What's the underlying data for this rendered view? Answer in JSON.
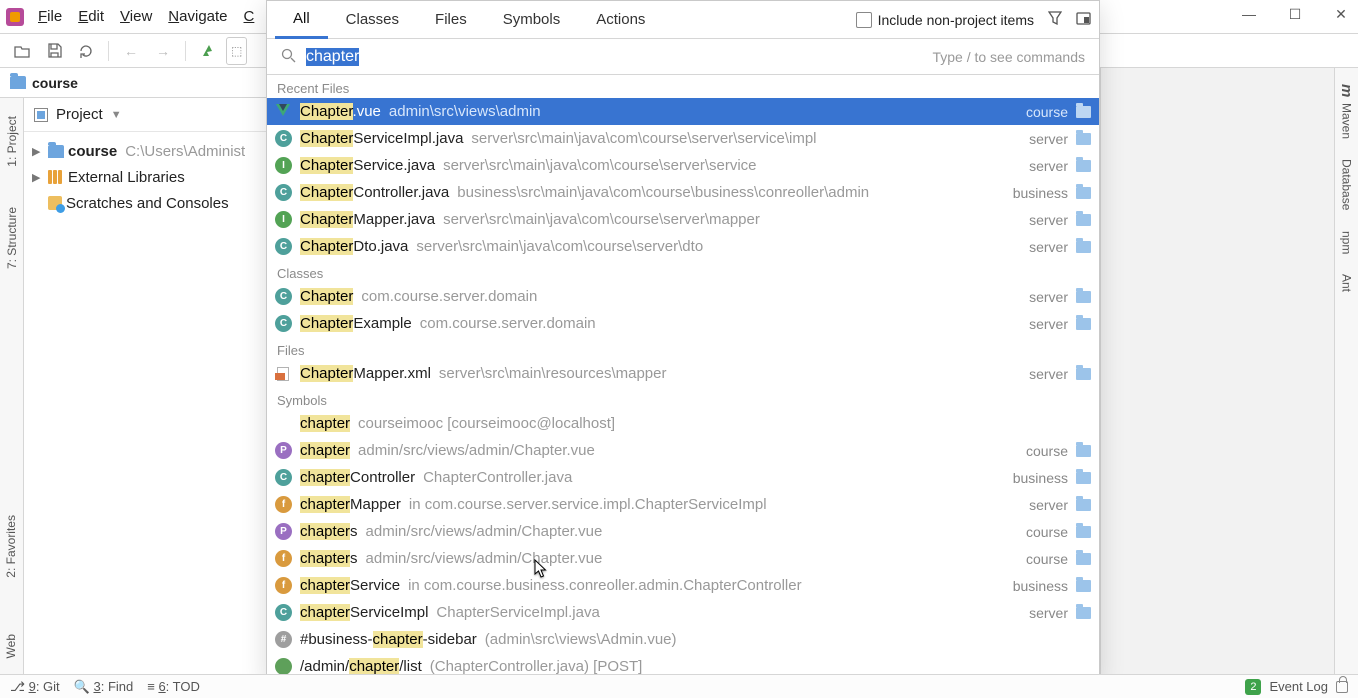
{
  "menu": {
    "file": "File",
    "edit": "Edit",
    "view": "View",
    "navigate": "Navigate",
    "code_initial": "C"
  },
  "toolbar": {},
  "breadcrumb": {
    "project": "course"
  },
  "leftpanel": {
    "header": "Project",
    "root": {
      "name": "course",
      "path": "C:\\Users\\Administ"
    },
    "external": "External Libraries",
    "scratches": "Scratches and Consoles"
  },
  "leftstripe": {
    "project": "1: Project",
    "structure": "7: Structure",
    "favorites": "2: Favorites",
    "web": "Web"
  },
  "rightstripe": {
    "maven": "Maven",
    "m": "m",
    "database": "Database",
    "npm": "npm",
    "ant": "Ant"
  },
  "wincontrols": {},
  "popup": {
    "tabs": {
      "all": "All",
      "classes": "Classes",
      "files": "Files",
      "symbols": "Symbols",
      "actions": "Actions"
    },
    "include": "Include non-project items",
    "query": "chapter",
    "hint": "Type / to see commands",
    "sections": {
      "recent": "Recent Files",
      "classes": "Classes",
      "files": "Files",
      "symbols": "Symbols"
    },
    "recent": [
      {
        "icon": "vue",
        "name": "Chapter.vue",
        "hl": "Chapter",
        "tail": ".vue",
        "path": "admin\\src\\views\\admin",
        "mod": "course",
        "sel": true
      },
      {
        "icon": "cyan",
        "letter": "C",
        "name": "ChapterServiceImpl.java",
        "hl": "Chapter",
        "tail": "ServiceImpl.java",
        "path": "server\\src\\main\\java\\com\\course\\server\\service\\impl",
        "mod": "server"
      },
      {
        "icon": "int",
        "letter": "I",
        "name": "ChapterService.java",
        "hl": "Chapter",
        "tail": "Service.java",
        "path": "server\\src\\main\\java\\com\\course\\server\\service",
        "mod": "server"
      },
      {
        "icon": "cyan",
        "letter": "C",
        "name": "ChapterController.java",
        "hl": "Chapter",
        "tail": "Controller.java",
        "path": "business\\src\\main\\java\\com\\course\\business\\conreoller\\admin",
        "mod": "business"
      },
      {
        "icon": "int",
        "letter": "I",
        "name": "ChapterMapper.java",
        "hl": "Chapter",
        "tail": "Mapper.java",
        "path": "server\\src\\main\\java\\com\\course\\server\\mapper",
        "mod": "server"
      },
      {
        "icon": "cyan",
        "letter": "C",
        "name": "ChapterDto.java",
        "hl": "Chapter",
        "tail": "Dto.java",
        "path": "server\\src\\main\\java\\com\\course\\server\\dto",
        "mod": "server"
      }
    ],
    "classes": [
      {
        "icon": "cyan",
        "letter": "C",
        "name": "Chapter",
        "hl": "Chapter",
        "tail": "",
        "path": "com.course.server.domain",
        "mod": "server"
      },
      {
        "icon": "cyan",
        "letter": "C",
        "name": "ChapterExample",
        "hl": "Chapter",
        "tail": "Example",
        "path": "com.course.server.domain",
        "mod": "server"
      }
    ],
    "files": [
      {
        "icon": "xml",
        "name": "ChapterMapper.xml",
        "hl": "Chapter",
        "tail": "Mapper.xml",
        "path": "server\\src\\main\\resources\\mapper",
        "mod": "server"
      }
    ],
    "symbols": [
      {
        "icon": "grid",
        "name": "chapter",
        "hl": "chapter",
        "tail": "",
        "path": "courseimooc [courseimooc@localhost]",
        "mod": ""
      },
      {
        "icon": "purple",
        "letter": "P",
        "name": "chapter",
        "hl": "chapter",
        "tail": "",
        "path": "admin/src/views/admin/Chapter.vue",
        "mod": "course"
      },
      {
        "icon": "cyan",
        "letter": "C",
        "name": "chapterController",
        "hl": "chapter",
        "tail": "Controller",
        "path": "ChapterController.java",
        "mod": "business"
      },
      {
        "icon": "orange",
        "letter": "f",
        "name": "chapterMapper",
        "hl": "chapter",
        "tail": "Mapper",
        "path": "in com.course.server.service.impl.ChapterServiceImpl",
        "mod": "server"
      },
      {
        "icon": "purple",
        "letter": "P",
        "name": "chapters",
        "hl": "chapter",
        "tail": "s",
        "path": "admin/src/views/admin/Chapter.vue",
        "mod": "course"
      },
      {
        "icon": "orange",
        "letter": "f",
        "name": "chapters",
        "hl": "chapter",
        "tail": "s",
        "path": "admin/src/views/admin/Chapter.vue",
        "mod": "course"
      },
      {
        "icon": "orange",
        "letter": "f",
        "name": "chapterService",
        "hl": "chapter",
        "tail": "Service",
        "path": "in com.course.business.conreoller.admin.ChapterController",
        "mod": "business"
      },
      {
        "icon": "cyan",
        "letter": "C",
        "name": "chapterServiceImpl",
        "hl": "chapter",
        "tail": "ServiceImpl",
        "path": "ChapterServiceImpl.java",
        "mod": "server"
      },
      {
        "icon": "hash",
        "letter": "#",
        "name": "#business-chapter-sidebar",
        "hl": "chapter",
        "pre": "#business-",
        "tail": "-sidebar",
        "path": "(admin\\src\\views\\Admin.vue)",
        "mod": ""
      },
      {
        "icon": "route",
        "letter": "",
        "name": "/admin/chapter/list",
        "hl": "chapter",
        "pre": "/admin/",
        "tail": "/list",
        "path": "(ChapterController.java) [POST]",
        "mod": ""
      }
    ]
  },
  "status": {
    "git": "9: Git",
    "find": "3: Find",
    "tod": "6: TOD",
    "eventlog": "Event Log",
    "badge": "2"
  }
}
